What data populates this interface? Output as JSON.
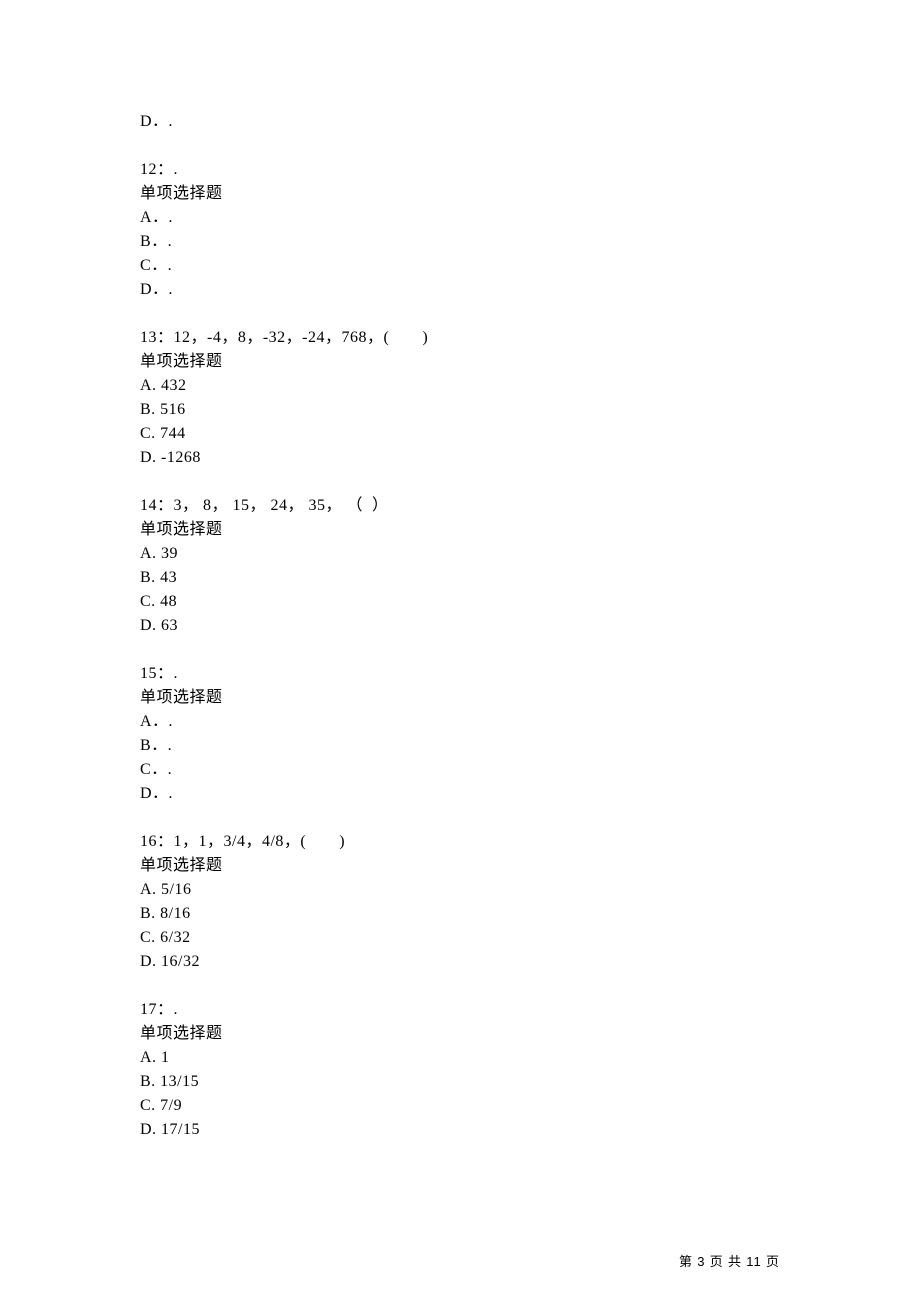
{
  "orphan_option": "D．.",
  "questions": [
    {
      "header": "12：.",
      "type": "单项选择题",
      "options": [
        "A．.",
        "B．.",
        "C．.",
        "D．."
      ]
    },
    {
      "header": "13：12，-4，8，-32，-24，768，(　　)",
      "type": "单项选择题",
      "options": [
        "A. 432",
        "B. 516",
        "C. 744",
        "D. -1268"
      ]
    },
    {
      "header": "14：3， 8， 15， 24， 35， （  ）",
      "type": "单项选择题",
      "options": [
        "A. 39",
        "B. 43",
        "C. 48",
        "D. 63"
      ]
    },
    {
      "header": "15：.",
      "type": "单项选择题",
      "options": [
        "A．.",
        "B．.",
        "C．.",
        "D．."
      ]
    },
    {
      "header": "16：1，1，3/4，4/8，(　　)",
      "type": "单项选择题",
      "options": [
        "A. 5/16",
        "B. 8/16",
        "C. 6/32",
        "D. 16/32"
      ]
    },
    {
      "header": "17：.",
      "type": "单项选择题",
      "options": [
        "A. 1",
        "B. 13/15",
        "C. 7/9",
        "D. 17/15"
      ]
    }
  ],
  "footer": {
    "prefix": "第 ",
    "page_current": "3",
    "mid": " 页 共 ",
    "page_total": "11",
    "suffix": " 页"
  }
}
